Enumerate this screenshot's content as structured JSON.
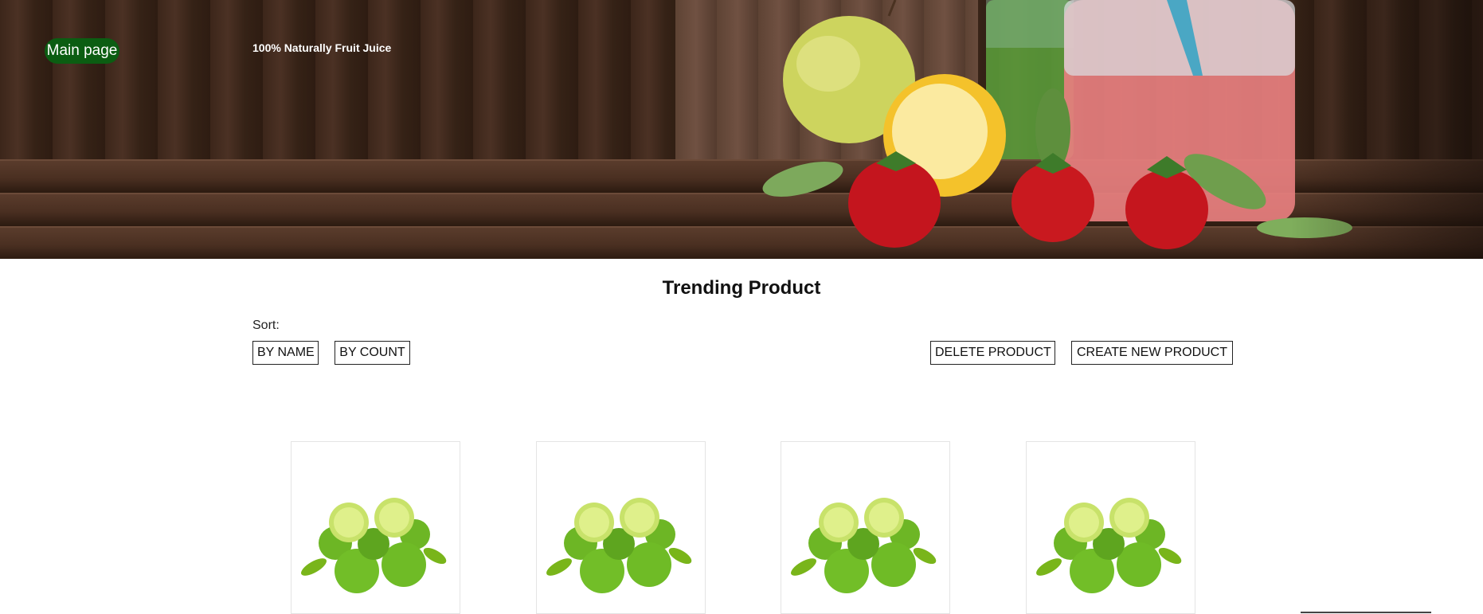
{
  "nav": {
    "main_page_label": "Main page"
  },
  "hero": {
    "tagline": "100% Naturally Fruit Juice"
  },
  "main": {
    "section_title": "Trending Product",
    "sort_label": "Sort:",
    "buttons": {
      "by_name": "BY NAME",
      "by_count": "BY COUNT",
      "delete_product": "DELETE PRODUCT",
      "create_new_product": "CREATE NEW PRODUCT"
    }
  },
  "products": [
    {
      "image": "limes-image"
    },
    {
      "image": "limes-image"
    },
    {
      "image": "limes-image"
    },
    {
      "image": "limes-image"
    }
  ],
  "colors": {
    "nav_pill": "#0b5d12",
    "hero_wood": "#3b2619",
    "button_border": "#222222"
  }
}
